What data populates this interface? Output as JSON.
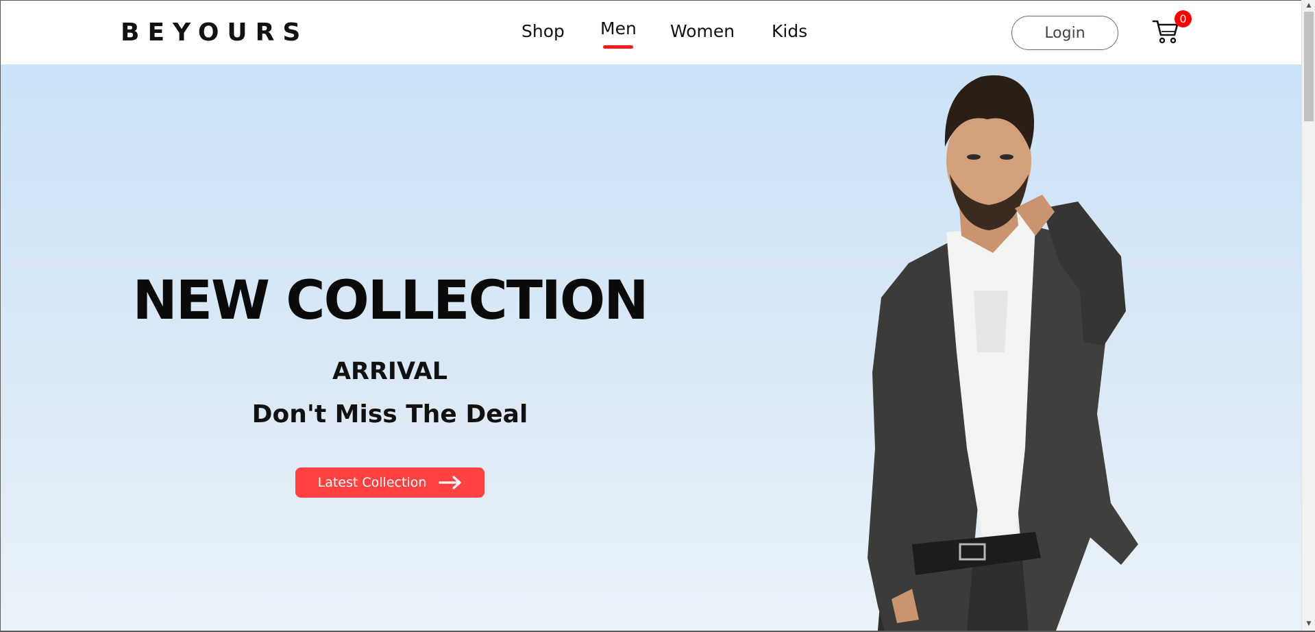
{
  "header": {
    "logo": "BEYOURS",
    "nav": {
      "shop": "Shop",
      "men": "Men",
      "women": "Women",
      "kids": "Kids"
    },
    "active_nav": "Men",
    "login_label": "Login",
    "cart_count": "0"
  },
  "hero": {
    "title": "NEW COLLECTION",
    "subtitle1": "ARRIVAL",
    "subtitle2": "Don't Miss The Deal",
    "cta_label": "Latest Collection"
  },
  "colors": {
    "accent": "#ff4141",
    "badge": "#ff0000",
    "hero_bg_top": "#cce2f6",
    "hero_bg_bottom": "#eaf2f9"
  },
  "icons": {
    "cart": "cart-icon",
    "arrow": "arrow-right-icon",
    "scroll_up": "scroll-up-arrow",
    "scroll_down": "scroll-down-arrow"
  }
}
